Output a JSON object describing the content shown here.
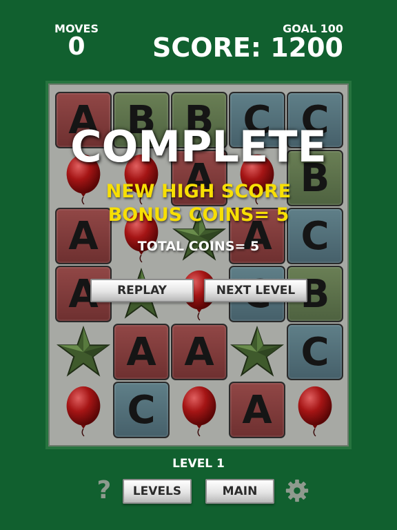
{
  "hud": {
    "moves_label": "MOVES",
    "moves_value": "0",
    "goal_label": "GOAL 100",
    "score_label": "SCORE: 1200"
  },
  "board": {
    "cols": 5,
    "rows": 6,
    "cells": [
      [
        {
          "kind": "tile",
          "color": "red",
          "letter": "A"
        },
        {
          "kind": "tile",
          "color": "green",
          "letter": "B"
        },
        {
          "kind": "tile",
          "color": "green",
          "letter": "B"
        },
        {
          "kind": "tile",
          "color": "blue",
          "letter": "C"
        },
        {
          "kind": "tile",
          "color": "blue",
          "letter": "C"
        }
      ],
      [
        {
          "kind": "balloon"
        },
        {
          "kind": "balloon"
        },
        {
          "kind": "tile",
          "color": "red",
          "letter": "A"
        },
        {
          "kind": "balloon"
        },
        {
          "kind": "tile",
          "color": "green",
          "letter": "B"
        }
      ],
      [
        {
          "kind": "tile",
          "color": "red",
          "letter": "A"
        },
        {
          "kind": "balloon"
        },
        {
          "kind": "star"
        },
        {
          "kind": "tile",
          "color": "red",
          "letter": "A"
        },
        {
          "kind": "tile",
          "color": "blue",
          "letter": "C"
        }
      ],
      [
        {
          "kind": "tile",
          "color": "red",
          "letter": "A"
        },
        {
          "kind": "star"
        },
        {
          "kind": "balloon"
        },
        {
          "kind": "tile",
          "color": "blue",
          "letter": "C"
        },
        {
          "kind": "tile",
          "color": "green",
          "letter": "B"
        }
      ],
      [
        {
          "kind": "star"
        },
        {
          "kind": "tile",
          "color": "red",
          "letter": "A"
        },
        {
          "kind": "tile",
          "color": "red",
          "letter": "A"
        },
        {
          "kind": "star"
        },
        {
          "kind": "tile",
          "color": "blue",
          "letter": "C"
        }
      ],
      [
        {
          "kind": "balloon"
        },
        {
          "kind": "tile",
          "color": "blue",
          "letter": "C"
        },
        {
          "kind": "balloon"
        },
        {
          "kind": "tile",
          "color": "red",
          "letter": "A"
        },
        {
          "kind": "balloon"
        }
      ]
    ]
  },
  "overlay": {
    "title": "COMPLETE",
    "new_high_score": "NEW HIGH SCORE",
    "bonus_coins": "BONUS COINS= 5",
    "total_coins": "TOTAL COINS= 5",
    "replay_label": "REPLAY",
    "next_level_label": "NEXT LEVEL"
  },
  "footer": {
    "level_label": "LEVEL 1",
    "help_glyph": "?",
    "levels_label": "LEVELS",
    "main_label": "MAIN"
  },
  "icons": {
    "help": "question-mark-icon",
    "settings": "gear-icon"
  },
  "colors": {
    "background": "#11602f",
    "tile_red": "#914746",
    "tile_blue": "#5f7f88",
    "tile_green": "#6a7f55",
    "highlight_text": "#f7df05"
  }
}
